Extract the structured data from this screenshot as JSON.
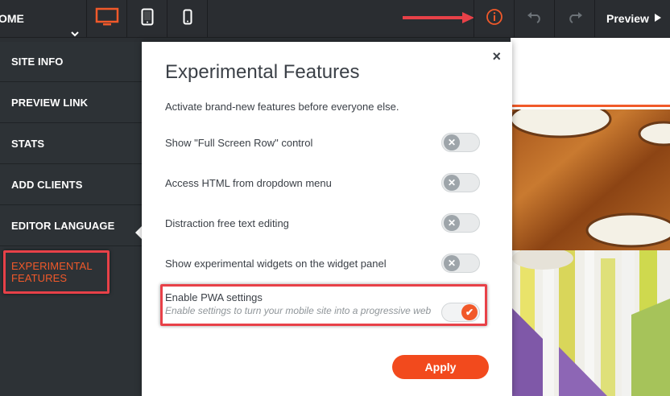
{
  "topbar": {
    "page_label": "OME",
    "preview_label": "Preview"
  },
  "colors": {
    "accent": "#f1592a",
    "annotation": "#e84148",
    "sidebar_bg": "#2d3236"
  },
  "icons": {
    "page_dropdown": "chevron-down-icon",
    "desktop": "desktop-icon",
    "tablet": "tablet-icon",
    "mobile": "mobile-icon",
    "info": "info-icon",
    "undo": "undo-icon",
    "redo": "redo-icon",
    "preview": "play-icon",
    "close": "close-icon"
  },
  "sidebar": {
    "items": [
      {
        "label": "SITE INFO"
      },
      {
        "label": "PREVIEW LINK"
      },
      {
        "label": "STATS"
      },
      {
        "label": "ADD CLIENTS"
      },
      {
        "label": "EDITOR LANGUAGE"
      },
      {
        "label": "EXPERIMENTAL FEATURES"
      }
    ]
  },
  "modal": {
    "close": "×",
    "title": "Experimental Features",
    "description": "Activate brand-new features before everyone else.",
    "features": [
      {
        "label": "Show \"Full Screen Row\" control",
        "enabled": false
      },
      {
        "label": "Access HTML from dropdown menu",
        "enabled": false
      },
      {
        "label": "Distraction free text editing",
        "enabled": false
      },
      {
        "label": "Show experimental widgets on the widget panel",
        "enabled": false
      },
      {
        "label": "Enable PWA settings",
        "description": "Enable settings to turn your mobile site into a progressive web",
        "enabled": true
      }
    ],
    "apply_label": "Apply"
  }
}
